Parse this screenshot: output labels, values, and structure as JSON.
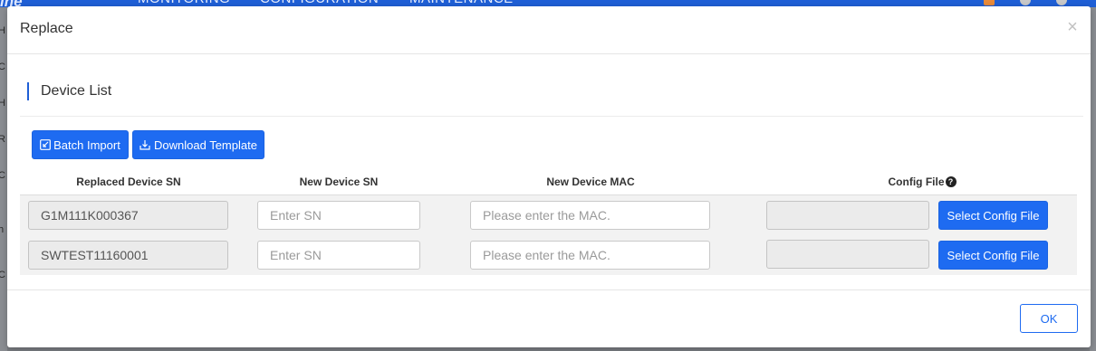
{
  "background": {
    "logo": "ine",
    "nav": [
      "MONITORING",
      "CONFIGURATION",
      "MAINTENANCE"
    ],
    "left_strip_letters": [
      "H",
      "C",
      "H",
      "R",
      "C",
      "h",
      "C"
    ]
  },
  "modal": {
    "title": "Replace",
    "close_symbol": "×",
    "section_title": "Device List",
    "toolbar": {
      "batch_import": "Batch Import",
      "download_template": "Download Template"
    },
    "columns": {
      "replaced_sn": "Replaced Device SN",
      "new_sn": "New Device SN",
      "new_mac": "New Device MAC",
      "config_file": "Config File",
      "help_symbol": "?"
    },
    "rows": [
      {
        "replaced_sn": "G1M111K000367",
        "new_sn_placeholder": "Enter SN",
        "mac_placeholder": "Please enter the MAC.",
        "config_file_value": "",
        "select_button": "Select Config File"
      },
      {
        "replaced_sn": "SWTEST11160001",
        "new_sn_placeholder": "Enter SN",
        "mac_placeholder": "Please enter the MAC.",
        "config_file_value": "",
        "select_button": "Select Config File"
      }
    ],
    "ok_label": "OK"
  },
  "colors": {
    "primary": "#1e6bf1",
    "overlay": "#7a7d82",
    "row_bg": "#f2f2f2"
  }
}
